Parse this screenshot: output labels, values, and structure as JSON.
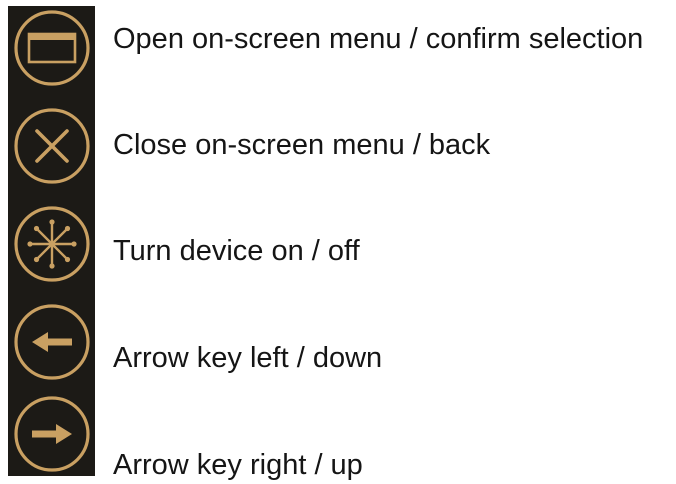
{
  "colors": {
    "panel": "#1c1a16",
    "accent": "#c9a062",
    "text": "#151515"
  },
  "legend": [
    {
      "icon": "menu-window-icon",
      "label": "Open on-screen menu / confirm selection"
    },
    {
      "icon": "close-x-icon",
      "label": "Close on-screen menu / back"
    },
    {
      "icon": "power-burst-icon",
      "label": "Turn device on / off"
    },
    {
      "icon": "arrow-left-icon",
      "label": "Arrow key left / down"
    },
    {
      "icon": "arrow-right-icon",
      "label": "Arrow key right / up"
    }
  ]
}
